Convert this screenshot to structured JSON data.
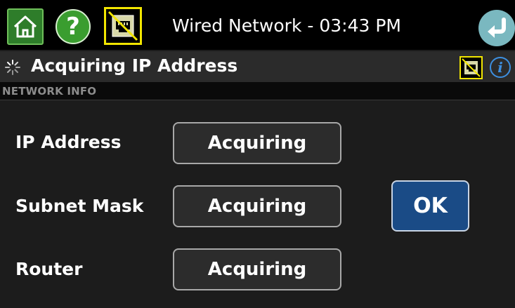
{
  "header": {
    "title": "Wired Network - 03:43 PM",
    "icons": {
      "home": "home-icon",
      "help": "help-icon",
      "network_status": "network-port-disconnected-icon",
      "back": "back-arrow-icon"
    },
    "help_glyph": "?"
  },
  "status": {
    "text": "Acquiring IP Address",
    "icons": {
      "spinner": "loading-spinner-icon",
      "network": "network-port-disconnected-icon",
      "info": "info-icon"
    },
    "info_glyph": "i"
  },
  "section": {
    "label": "NETWORK INFO"
  },
  "network_info": {
    "rows": [
      {
        "label": "IP Address",
        "value": "Acquiring"
      },
      {
        "label": "Subnet Mask",
        "value": "Acquiring"
      },
      {
        "label": "Router",
        "value": "Acquiring"
      }
    ],
    "ok_label": "OK"
  },
  "colors": {
    "topbar_bg": "#000000",
    "status_bg": "#2b2b2b",
    "main_bg": "#1c1c1c",
    "home_green": "#2e7d2a",
    "help_green": "#3a9d2f",
    "warning_yellow": "#f2e600",
    "back_teal": "#7ab8c0",
    "info_blue": "#3d8fe0",
    "ok_blue": "#1a4b86"
  }
}
